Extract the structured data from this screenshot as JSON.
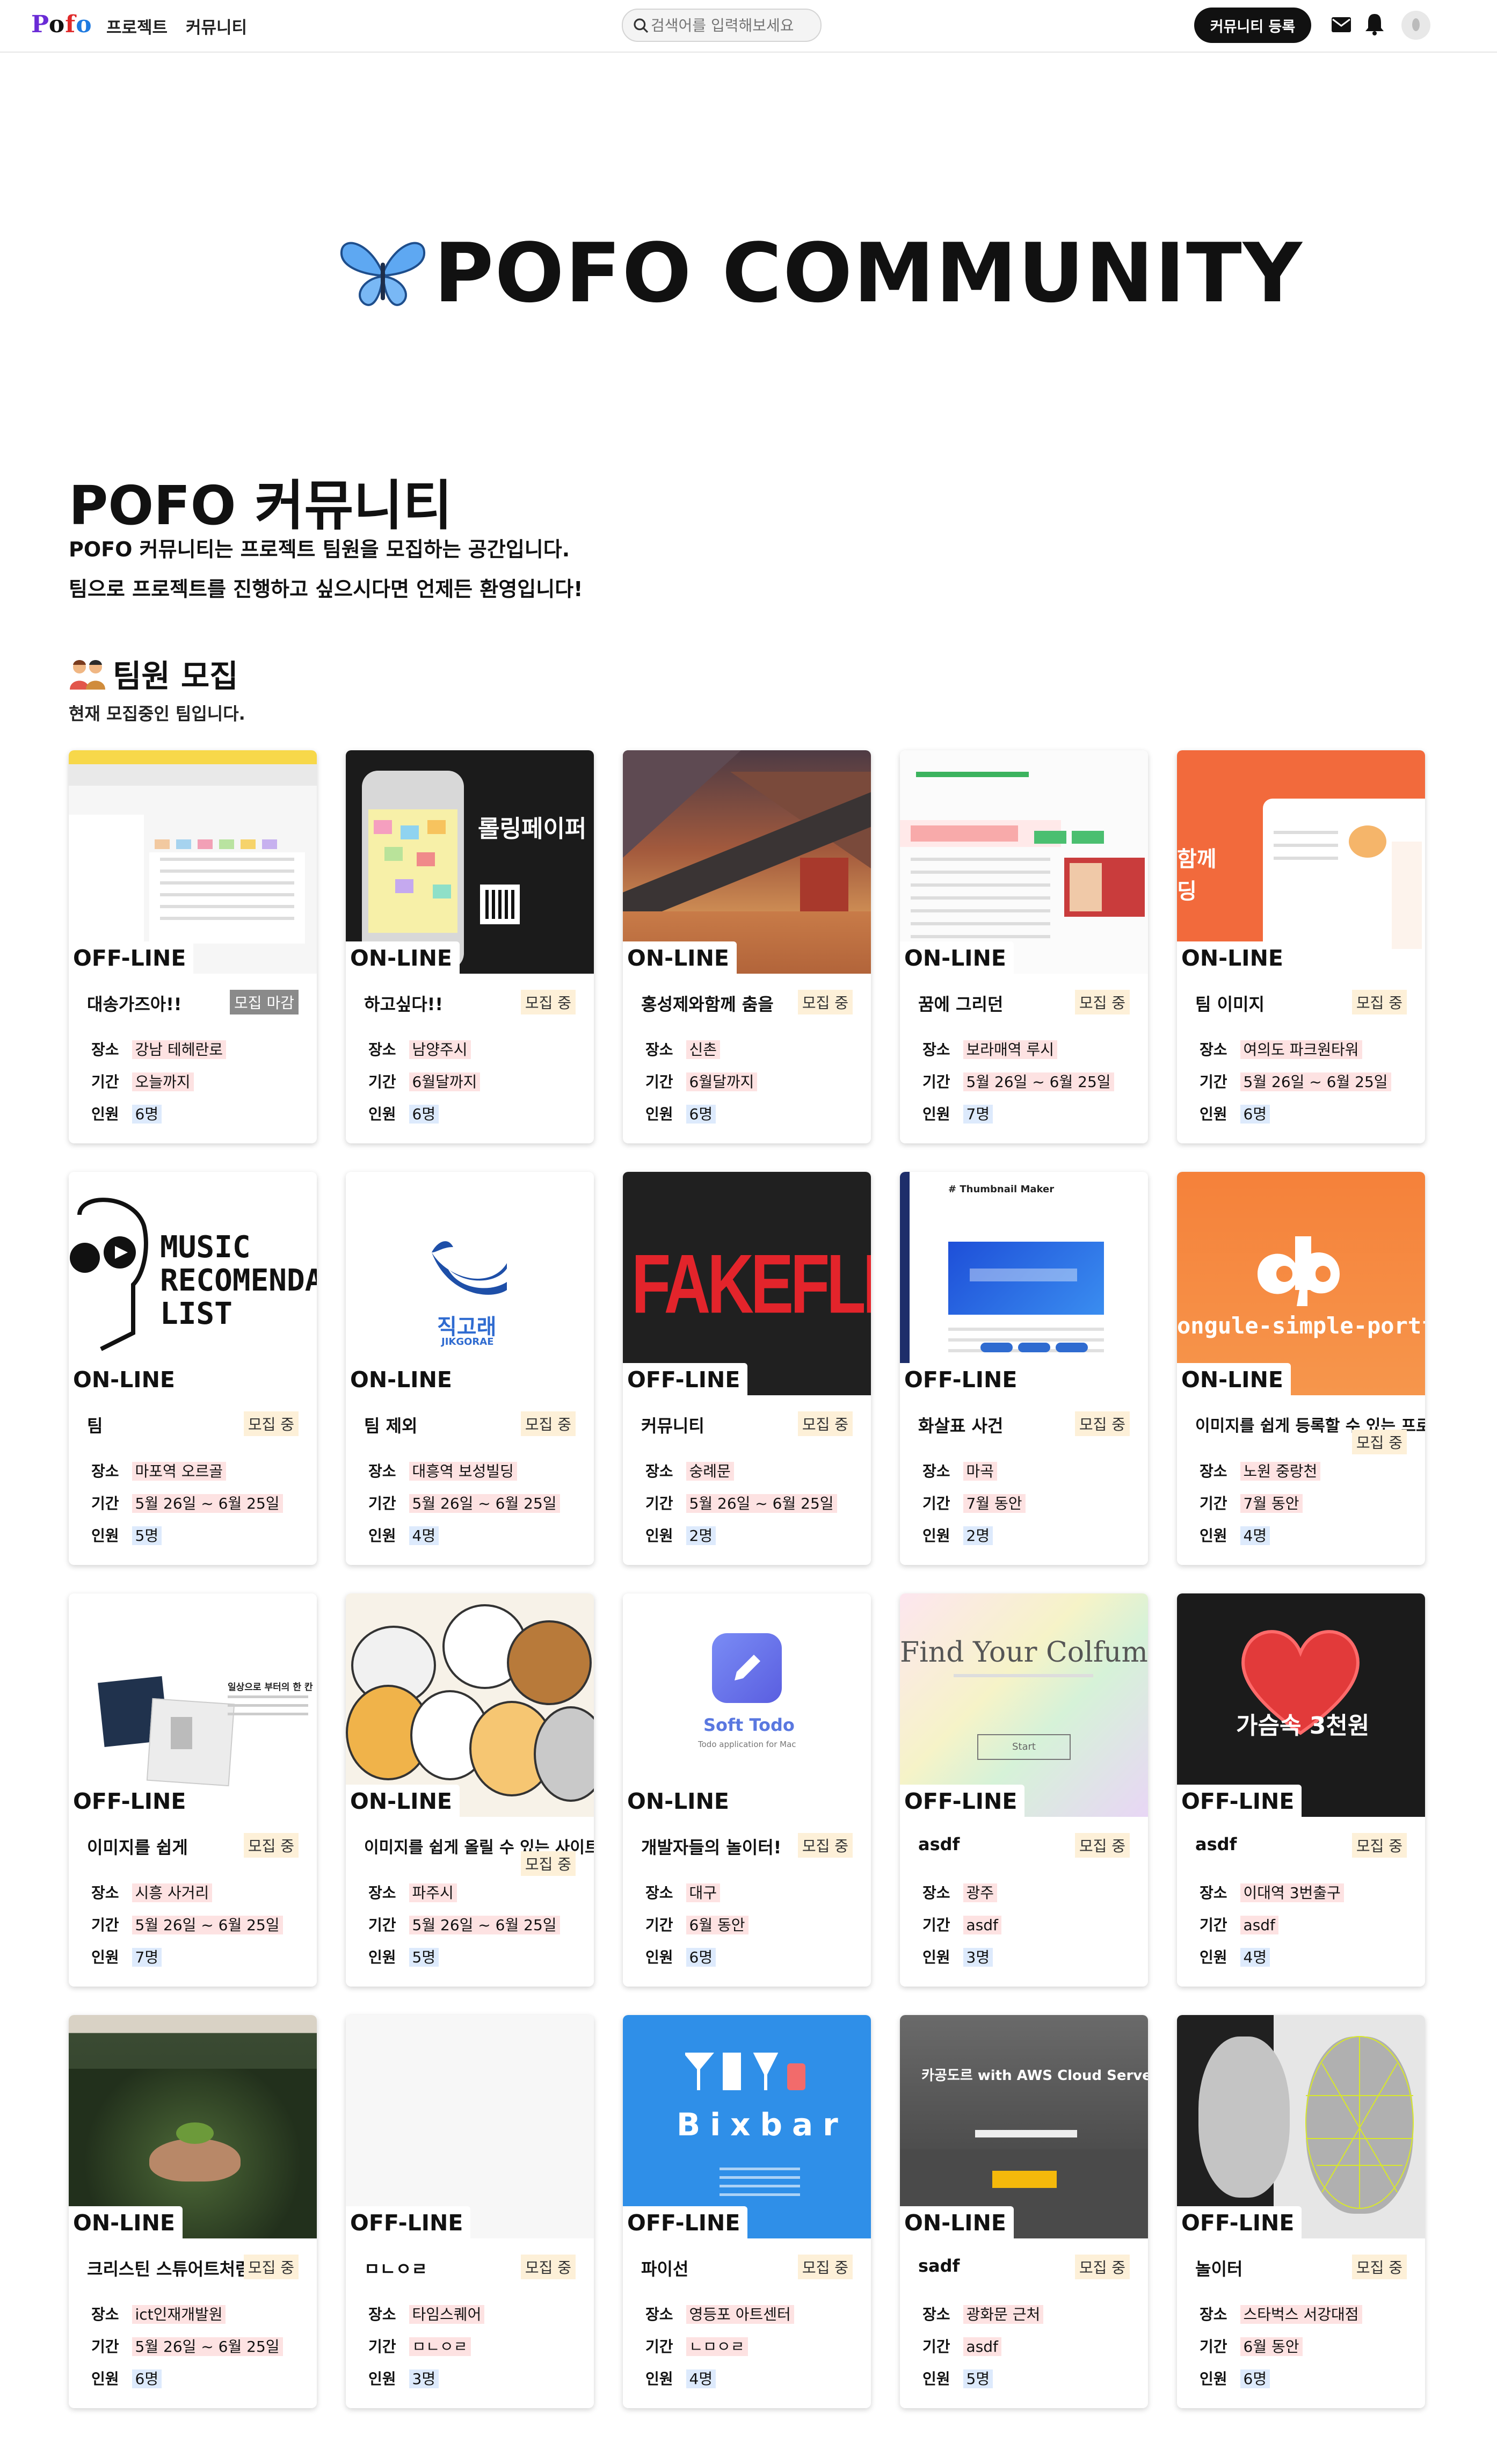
{
  "nav": {
    "logo": {
      "p": "P",
      "o": "o",
      "f": "f",
      "o2": "o"
    },
    "links": [
      "프로젝트",
      "커뮤니티"
    ],
    "search_placeholder": "검색어를 입력해보세요",
    "register_button": "커뮤니티 등록"
  },
  "hero": {
    "emoji": "🦋",
    "title": "POFO COMMUNITY"
  },
  "intro": {
    "title": "POFO 커뮤니티",
    "line1": "POFO 커뮤니티는 프로젝트 팀원을 모집하는 공간입니다.",
    "line2": "팀으로 프로젝트를 진행하고 싶으시다면 언제든 환영입니다!"
  },
  "section": {
    "emoji": "🧑‍🤝‍🧑",
    "title": "팀원 모집",
    "desc": "현재 모집중인 팀입니다."
  },
  "labels": {
    "place": "장소",
    "period": "기간",
    "people": "인원"
  },
  "colors": {
    "accent": "#111111",
    "loc_bg": "#fde2e2",
    "count_bg": "#ddeafc",
    "status_bg": "#fdf0d8",
    "closed_bg": "#8a8a8a"
  },
  "cards": [
    {
      "mode": "OFF-LINE",
      "title": "대송가즈아!!",
      "status": "모집 마감",
      "place": "강남 테헤란로",
      "period": "오늘까지",
      "people": "6명",
      "thumb": "todo-app-screenshot"
    },
    {
      "mode": "ON-LINE",
      "title": "하고싶다!!",
      "status": "모집 중",
      "place": "남양주시",
      "period": "6월달까지",
      "people": "6명",
      "thumb": "rolling-paper",
      "thumb_text": "롤링페이퍼"
    },
    {
      "mode": "ON-LINE",
      "title": "홍성제와함께 춤을",
      "status": "모집 중",
      "place": "신촌",
      "period": "6월달까지",
      "people": "6명",
      "thumb": "lowpoly-desert"
    },
    {
      "mode": "ON-LINE",
      "title": "꿈에 그리던",
      "status": "모집 중",
      "place": "보라매역 루시",
      "period": "5월 26일 ~ 6월 25일",
      "people": "7명",
      "thumb": "shopping-site"
    },
    {
      "mode": "ON-LINE",
      "title": "팀 이미지",
      "status": "모집 중",
      "place": "여의도 파크원타워",
      "period": "5월 26일 ~ 6월 25일",
      "people": "6명",
      "thumb": "orange-app",
      "thumb_text": "함께"
    },
    {
      "mode": "ON-LINE",
      "title": "팀",
      "status": "모집 중",
      "place": "마포역 오르골",
      "period": "5월 26일 ~ 6월 25일",
      "people": "5명",
      "thumb": "music-list",
      "thumb_text": "MUSIC RECOMENDATI LIST"
    },
    {
      "mode": "ON-LINE",
      "title": "팀 제외",
      "status": "모집 중",
      "place": "대흥역 보성빌딩",
      "period": "5월 26일 ~ 6월 25일",
      "people": "4명",
      "thumb": "jikgorae",
      "thumb_text": "직고래",
      "thumb_sub": "JIKGORAE"
    },
    {
      "mode": "OFF-LINE",
      "title": "커뮤니티",
      "status": "모집 중",
      "place": "숭례문",
      "period": "5월 26일 ~ 6월 25일",
      "people": "2명",
      "thumb": "fakeflix",
      "thumb_text": "FAKEFLIX"
    },
    {
      "mode": "OFF-LINE",
      "title": "화살표 사건",
      "status": "모집 중",
      "place": "마곡",
      "period": "7월 동안",
      "people": "2명",
      "thumb": "thumbnail-maker",
      "thumb_text": "# Thumbnail Maker"
    },
    {
      "mode": "ON-LINE",
      "title": "이미지를 쉽게 등록할 수 있는 프로젝트",
      "status": "모집 중",
      "place": "노원 중랑천",
      "period": "7월 동안",
      "people": "4명",
      "thumb": "dp-logo",
      "thumb_text": "ongule-simple-portfo"
    },
    {
      "mode": "OFF-LINE",
      "title": "이미지를 쉽게",
      "status": "모집 중",
      "place": "시흥 사거리",
      "period": "5월 26일 ~ 6월 25일",
      "people": "7명",
      "thumb": "product-boxes",
      "thumb_text": "일상으로 부터의 한 칸"
    },
    {
      "mode": "ON-LINE",
      "title": "이미지를 쉽게 올릴 수 있는 사이트",
      "status": "모집 중",
      "place": "파주시",
      "period": "5월 26일 ~ 6월 25일",
      "people": "5명",
      "thumb": "cartoon-animals"
    },
    {
      "mode": "ON-LINE",
      "title": "개발자들의 놀이터!",
      "status": "모집 중",
      "place": "대구",
      "period": "6월 동안",
      "people": "6명",
      "thumb": "soft-todo",
      "thumb_text": "Soft Todo",
      "thumb_sub": "Todo application for Mac"
    },
    {
      "mode": "OFF-LINE",
      "title": "asdf",
      "status": "모집 중",
      "place": "광주",
      "period": "asdf",
      "people": "3명",
      "thumb": "colfume",
      "thumb_text": "Find Your Colfume",
      "thumb_sub": "Start"
    },
    {
      "mode": "OFF-LINE",
      "title": "asdf",
      "status": "모집 중",
      "place": "이대역 3번출구",
      "period": "asdf",
      "people": "4명",
      "thumb": "heart-banner",
      "thumb_text": "가슴속 3천원"
    },
    {
      "mode": "ON-LINE",
      "title": "크리스틴 스튜어트처럼",
      "status": "모집 중",
      "place": "ict인재개발원",
      "period": "5월 26일 ~ 6월 25일",
      "people": "6명",
      "thumb": "plant-hands"
    },
    {
      "mode": "OFF-LINE",
      "title": "ㅁㄴㅇㄹ",
      "status": "모집 중",
      "place": "타임스퀘어",
      "period": "ㅁㄴㅇㄹ",
      "people": "3명",
      "thumb": "blank"
    },
    {
      "mode": "OFF-LINE",
      "title": "파이선",
      "status": "모집 중",
      "place": "영등포 아트센터",
      "period": "ㄴㅁㅇㄹ",
      "people": "4명",
      "thumb": "bixbar",
      "thumb_text": "Bixbar"
    },
    {
      "mode": "ON-LINE",
      "title": "sadf",
      "status": "모집 중",
      "place": "광화문 근처",
      "period": "asdf",
      "people": "5명",
      "thumb": "aws-banner",
      "thumb_text": "카공도르 with AWS Cloud Server"
    },
    {
      "mode": "OFF-LINE",
      "title": "놀이터",
      "status": "모집 중",
      "place": "스타벅스 서강대점",
      "period": "6월 동안",
      "people": "6명",
      "thumb": "face-mesh"
    }
  ]
}
